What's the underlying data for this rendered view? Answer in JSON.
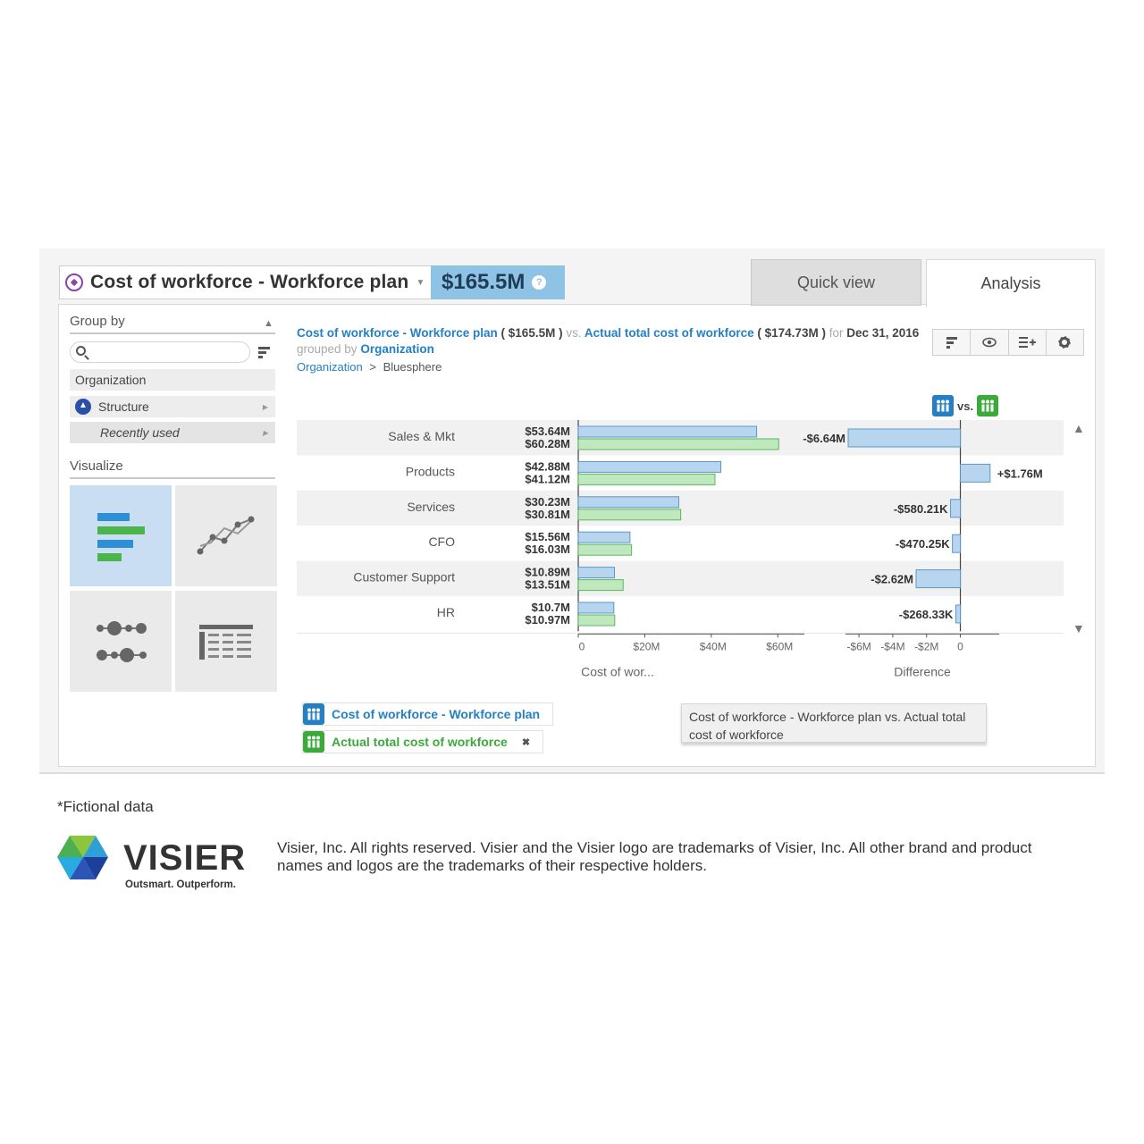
{
  "header": {
    "title": "Cost of workforce - Workforce plan",
    "value": "$165.5M",
    "help": "?"
  },
  "tabs": [
    {
      "label": "Quick view"
    },
    {
      "label": "Analysis"
    }
  ],
  "sidebar": {
    "group_by_label": "Group by",
    "search_placeholder": "",
    "items": [
      {
        "label": "Organization"
      },
      {
        "label": "Structure"
      },
      {
        "label": "Recently used"
      }
    ],
    "visualize_label": "Visualize"
  },
  "chart_header": {
    "metric1": "Cost of workforce - Workforce plan",
    "metric1_value": "( $165.5M )",
    "vs": "vs.",
    "metric2": "Actual total cost of workforce",
    "metric2_value": "( $174.73M )",
    "for": "for",
    "date": "Dec 31, 2016",
    "grouped_by": "grouped by",
    "group": "Organization",
    "crumb_root": "Organization",
    "crumb_sep": ">",
    "crumb_leaf": "Bluesphere",
    "vs_label": "vs."
  },
  "chart_data": {
    "type": "bar",
    "categories": [
      "Sales & Mkt",
      "Products",
      "Services",
      "CFO",
      "Customer Support",
      "HR"
    ],
    "series": [
      {
        "name": "Cost of workforce - Workforce plan",
        "values": [
          53.64,
          42.88,
          30.23,
          15.56,
          10.89,
          10.7
        ],
        "labels": [
          "$53.64M",
          "$42.88M",
          "$30.23M",
          "$15.56M",
          "$10.89M",
          "$10.7M"
        ],
        "color": "#b7d5ee"
      },
      {
        "name": "Actual total cost of workforce",
        "values": [
          60.28,
          41.12,
          30.81,
          16.03,
          13.51,
          10.97
        ],
        "labels": [
          "$60.28M",
          "$41.12M",
          "$30.81M",
          "$16.03M",
          "$13.51M",
          "$10.97M"
        ],
        "color": "#bfe8bf"
      }
    ],
    "difference": {
      "values": [
        -6.64,
        1.76,
        -0.58021,
        -0.47025,
        -2.62,
        -0.26833
      ],
      "labels": [
        "-$6.64M",
        "+$1.76M",
        "-$580.21K",
        "-$470.25K",
        "-$2.62M",
        "-$268.33K"
      ],
      "xlim": [
        -6.8,
        2.3
      ],
      "ticks": [
        "-$6M",
        "-$4M",
        "-$2M",
        "0"
      ],
      "tick_values": [
        -6,
        -4,
        -2,
        0
      ],
      "xlabel": "Difference"
    },
    "xlim": [
      0,
      68
    ],
    "ticks": [
      "0",
      "$20M",
      "$40M",
      "$60M"
    ],
    "tick_values": [
      0,
      20,
      40,
      60
    ],
    "xlabel": "Cost of wor..."
  },
  "legend": [
    {
      "label": "Cost of workforce - Workforce plan",
      "color": "#2580c3"
    },
    {
      "label": "Actual total cost of workforce",
      "color": "#3aab3a",
      "remove": "✖"
    }
  ],
  "tooltip": "Cost of workforce - Workforce plan vs. Actual total cost of workforce",
  "footer": {
    "footnote": "*Fictional data",
    "brand": "VISIER",
    "tagline": "Outsmart. Outperform.",
    "legal": "Visier, Inc. All rights reserved. Visier and the Visier logo are trademarks of Visier, Inc. All other brand and product names and logos are the trademarks of their respective holders."
  }
}
